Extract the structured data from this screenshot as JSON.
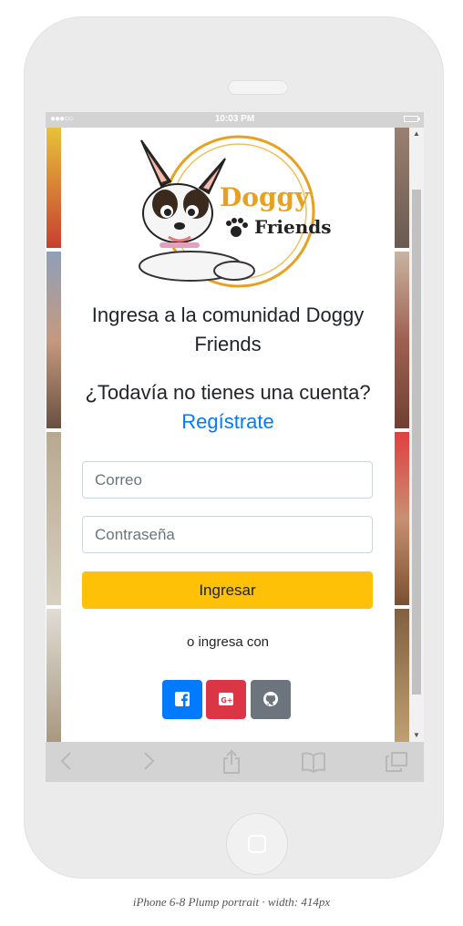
{
  "status_bar": {
    "time": "10:03 PM",
    "signal": "●●●○○"
  },
  "logo": {
    "line1": "Doggy",
    "line2": "Friends"
  },
  "page": {
    "heading": "Ingresa a la comunidad Doggy Friends",
    "no_account_text": "¿Todavía no tienes una cuenta?",
    "register_link": "Regístrate",
    "email_placeholder": "Correo",
    "password_placeholder": "Contraseña",
    "login_button": "Ingresar",
    "or_text": "o ingresa con"
  },
  "social_buttons": [
    {
      "name": "facebook",
      "icon": "facebook-icon",
      "color": "#007bff"
    },
    {
      "name": "google-plus",
      "icon": "google-plus-icon",
      "color": "#dc3545"
    },
    {
      "name": "github",
      "icon": "github-icon",
      "color": "#6c757d"
    }
  ],
  "caption": "iPhone 6-8 Plump portrait · width: 414px",
  "colors": {
    "accent": "#007bff",
    "login": "#ffc107",
    "logo_orange": "#e8a020"
  }
}
